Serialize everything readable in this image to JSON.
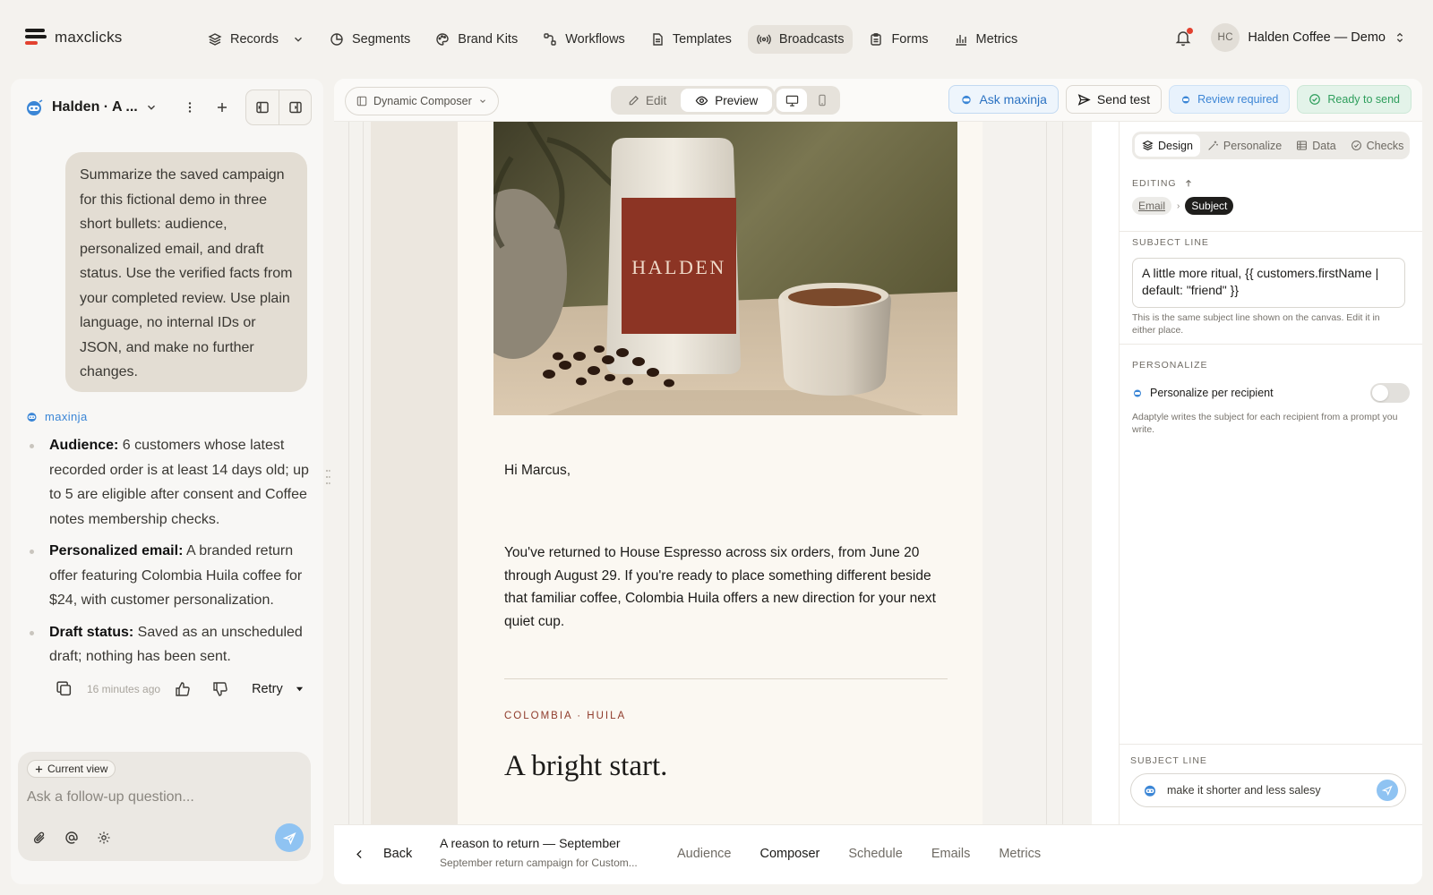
{
  "colors": {
    "accent_blue": "#3b86d6",
    "brand_red": "#e2412f",
    "notification_red": "#e2412f",
    "ready_green": "#2e9e5c",
    "send_button_blue": "#8fc3f2"
  },
  "brand": {
    "name": "maxclicks"
  },
  "nav": {
    "items": [
      {
        "label": "Records",
        "icon": "layers-icon",
        "has_dropdown": true
      },
      {
        "label": "Segments",
        "icon": "pie-icon"
      },
      {
        "label": "Brand Kits",
        "icon": "palette-icon"
      },
      {
        "label": "Workflows",
        "icon": "workflow-icon"
      },
      {
        "label": "Templates",
        "icon": "document-icon"
      },
      {
        "label": "Broadcasts",
        "icon": "broadcast-icon",
        "active": true
      },
      {
        "label": "Forms",
        "icon": "clipboard-icon"
      },
      {
        "label": "Metrics",
        "icon": "bar-chart-icon"
      }
    ],
    "account": {
      "initials": "HC",
      "name": "Halden Coffee — Demo"
    }
  },
  "chat": {
    "title": "Halden · A ...",
    "user_message": "Summarize the saved campaign for this fictional demo in three short bullets: audience, personalized email, and draft status. Use the verified facts from your completed review. Use plain language, no internal IDs or JSON, and make no further changes.",
    "bot_name": "maxinja",
    "bullets": [
      {
        "label": "Audience:",
        "text": " 6 customers whose latest recorded order is at least 14 days old; up to 5 are eligible after consent and Coffee notes membership checks."
      },
      {
        "label": "Personalized email:",
        "text": " A branded return offer featuring Colombia Huila coffee for $24, with customer personalization."
      },
      {
        "label": "Draft status:",
        "text": " Saved as an unscheduled draft; nothing has been sent."
      }
    ],
    "timestamp": "16 minutes ago",
    "retry_label": "Retry",
    "context_chip": "Current view",
    "input_placeholder": "Ask a follow-up question..."
  },
  "toolbar": {
    "composer_mode": "Dynamic Composer",
    "edit_label": "Edit",
    "preview_label": "Preview",
    "ask_label": "Ask maxinja",
    "send_test_label": "Send test",
    "review_label": "Review required",
    "ready_label": "Ready to send"
  },
  "email": {
    "brand_on_bag": "HALDEN",
    "greeting": "Hi Marcus,",
    "body": "You've returned to House Espresso across six orders, from June 20 through August 29. If you're ready to place something different beside that familiar coffee, Colombia Huila offers a new direction for your next quiet cup.",
    "kicker": "COLOMBIA · HUILA",
    "headline": "A bright start."
  },
  "inspector": {
    "tabs": [
      {
        "label": "Design",
        "icon": "layers-icon",
        "active": true
      },
      {
        "label": "Personalize",
        "icon": "wand-icon"
      },
      {
        "label": "Data",
        "icon": "table-icon"
      },
      {
        "label": "Checks",
        "icon": "check-circle-icon"
      }
    ],
    "editing_label": "EDITING",
    "crumb_email": "Email",
    "crumb_subject": "Subject",
    "subject_line_label": "SUBJECT LINE",
    "subject_value": "A little more ritual, {{ customers.firstName | default: \"friend\" }}",
    "subject_help": "This is the same subject line shown on the canvas. Edit it in either place.",
    "personalize_label": "PERSONALIZE",
    "personalize_toggle_label": "Personalize per recipient",
    "personalize_enabled": false,
    "personalize_help": "Adaptyle writes the subject for each recipient from a prompt you write.",
    "bottom_label": "SUBJECT LINE",
    "prompt_value": "make it shorter and less salesy"
  },
  "footer": {
    "back_label": "Back",
    "campaign_title": "A reason to return — September",
    "campaign_subtitle": "September return campaign for Custom...",
    "steps": [
      {
        "label": "Audience"
      },
      {
        "label": "Composer",
        "active": true
      },
      {
        "label": "Schedule"
      },
      {
        "label": "Emails"
      },
      {
        "label": "Metrics"
      }
    ]
  }
}
